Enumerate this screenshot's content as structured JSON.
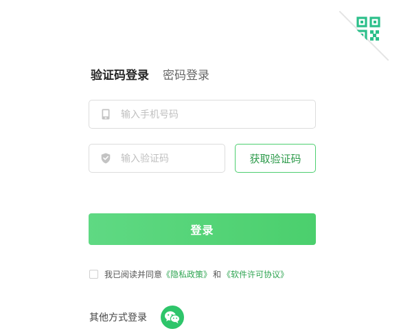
{
  "tabs": [
    {
      "label": "验证码登录",
      "active": true
    },
    {
      "label": "密码登录",
      "active": false
    }
  ],
  "phone": {
    "placeholder": "输入手机号码"
  },
  "code": {
    "placeholder": "输入验证码"
  },
  "get_code_label": "获取验证码",
  "login_label": "登录",
  "agreement": {
    "prefix": "我已阅读并同意",
    "privacy": "《隐私政策》",
    "and": "和",
    "license": "《软件许可协议》",
    "checked": false
  },
  "other_login": {
    "label": "其他方式登录",
    "icon": "wechat-icon"
  },
  "colors": {
    "accent": "#4bce6e",
    "accent_dark": "#2c9a4a",
    "qr": "#2bbf8a",
    "wechat": "#2ec56a"
  },
  "icons": {
    "qr_corner": "qr-code-icon",
    "phone_field": "phone-icon",
    "code_field": "shield-icon"
  }
}
